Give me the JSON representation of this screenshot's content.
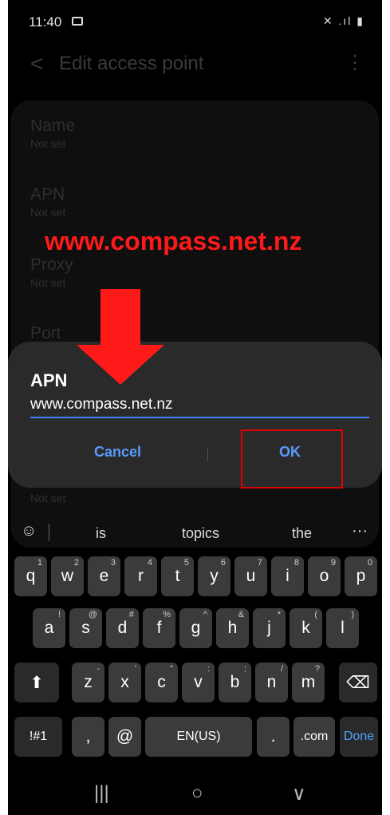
{
  "status": {
    "time": "11:40",
    "icons": "✕ .ıl ▮"
  },
  "appbar": {
    "back": "<",
    "title": "Edit access point",
    "more": "⋮"
  },
  "fields": [
    {
      "label": "Name",
      "value": "Not set"
    },
    {
      "label": "APN",
      "value": "Not set"
    },
    {
      "label": "Proxy",
      "value": "Not set"
    },
    {
      "label": "Port",
      "value": ""
    }
  ],
  "overlay": {
    "text": "www.compass.net.nz",
    "arrow_color": "#ff1a1a"
  },
  "dialog": {
    "title": "APN",
    "input_value": "www.compass.net.nz",
    "cancel_label": "Cancel",
    "ok_label": "OK"
  },
  "below_value": "Not set",
  "suggestions": {
    "words": [
      "is",
      "topics",
      "the"
    ],
    "more": "···"
  },
  "keyboard": {
    "row1": [
      [
        "q",
        "1"
      ],
      [
        "w",
        "2"
      ],
      [
        "e",
        "3"
      ],
      [
        "r",
        "4"
      ],
      [
        "t",
        "5"
      ],
      [
        "y",
        "6"
      ],
      [
        "u",
        "7"
      ],
      [
        "i",
        "8"
      ],
      [
        "o",
        "9"
      ],
      [
        "p",
        "0"
      ]
    ],
    "row2": [
      [
        "a",
        "!"
      ],
      [
        "s",
        "@"
      ],
      [
        "d",
        "#"
      ],
      [
        "f",
        "%"
      ],
      [
        "g",
        "^"
      ],
      [
        "h",
        "&"
      ],
      [
        "j",
        "*"
      ],
      [
        "k",
        "("
      ],
      [
        "l",
        ")"
      ]
    ],
    "row3": [
      [
        "z",
        "-"
      ],
      [
        "x",
        "'"
      ],
      [
        "c",
        "\""
      ],
      [
        "v",
        ":"
      ],
      [
        "b",
        ";"
      ],
      [
        "n",
        "/"
      ],
      [
        "m",
        "?"
      ]
    ],
    "row4": {
      "symbols": "!#1",
      "comma": ",",
      "at": "@",
      "space": "EN(US)",
      "period": ".",
      "com": ".com",
      "done": "Done"
    }
  },
  "navbar": {
    "recent": "|||",
    "home": "○",
    "back": "∨"
  },
  "colors": {
    "accent": "#5b9bff",
    "highlight": "#e00000"
  }
}
